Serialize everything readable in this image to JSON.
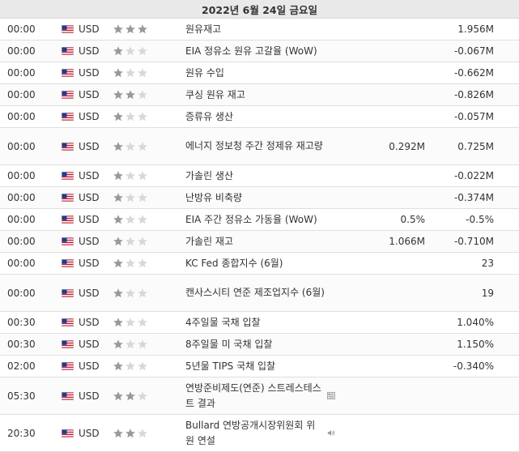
{
  "date_header": "2022년 6월 24일 금요일",
  "colors": {
    "star_on": "#999999",
    "star_off": "#d8d8d8",
    "border": "#dfdfdf",
    "header_bg": "#e9e9e9"
  },
  "events": [
    {
      "time": "00:00",
      "currency": "USD",
      "importance": 3,
      "title": "원유재고",
      "actual": "",
      "forecast": "1.956M"
    },
    {
      "time": "00:00",
      "currency": "USD",
      "importance": 1,
      "title": "EIA 정유소 원유 고갈율 (WoW)",
      "actual": "",
      "forecast": "-0.067M"
    },
    {
      "time": "00:00",
      "currency": "USD",
      "importance": 1,
      "title": "원유 수입",
      "actual": "",
      "forecast": "-0.662M"
    },
    {
      "time": "00:00",
      "currency": "USD",
      "importance": 2,
      "title": "쿠싱 원유 재고",
      "actual": "",
      "forecast": "-0.826M"
    },
    {
      "time": "00:00",
      "currency": "USD",
      "importance": 1,
      "title": "증류유 생산",
      "actual": "",
      "forecast": "-0.057M"
    },
    {
      "time": "00:00",
      "currency": "USD",
      "importance": 1,
      "title": "에너지 정보청 주간 정제유 재고량",
      "actual": "0.292M",
      "forecast": "0.725M"
    },
    {
      "time": "00:00",
      "currency": "USD",
      "importance": 1,
      "title": "가솔린 생산",
      "actual": "",
      "forecast": "-0.022M"
    },
    {
      "time": "00:00",
      "currency": "USD",
      "importance": 1,
      "title": "난방유 비축량",
      "actual": "",
      "forecast": "-0.374M"
    },
    {
      "time": "00:00",
      "currency": "USD",
      "importance": 1,
      "title": "EIA 주간 정유소 가동율 (WoW)",
      "actual": "0.5%",
      "forecast": "-0.5%"
    },
    {
      "time": "00:00",
      "currency": "USD",
      "importance": 1,
      "title": "가솔린 재고",
      "actual": "1.066M",
      "forecast": "-0.710M"
    },
    {
      "time": "00:00",
      "currency": "USD",
      "importance": 1,
      "title": "KC Fed 종합지수 (6월)",
      "actual": "",
      "forecast": "23"
    },
    {
      "time": "00:00",
      "currency": "USD",
      "importance": 1,
      "title": "캔사스시티 연준 제조업지수 (6월)",
      "actual": "",
      "forecast": "19"
    },
    {
      "time": "00:30",
      "currency": "USD",
      "importance": 1,
      "title": "4주일물 국채 입찰",
      "actual": "",
      "forecast": "1.040%"
    },
    {
      "time": "00:30",
      "currency": "USD",
      "importance": 1,
      "title": "8주일물 미 국채 입찰",
      "actual": "",
      "forecast": "1.150%"
    },
    {
      "time": "02:00",
      "currency": "USD",
      "importance": 1,
      "title": "5년물 TIPS 국채 입찰",
      "actual": "",
      "forecast": "-0.340%"
    },
    {
      "time": "05:30",
      "currency": "USD",
      "importance": 2,
      "title": "연방준비제도(연준) 스트레스테스트 결과",
      "actual": "",
      "forecast": "",
      "icon": "document-icon"
    },
    {
      "time": "20:30",
      "currency": "USD",
      "importance": 2,
      "title": "Bullard 연방공개시장위원회 위원 연설",
      "actual": "",
      "forecast": "",
      "icon": "speaker-icon"
    }
  ]
}
